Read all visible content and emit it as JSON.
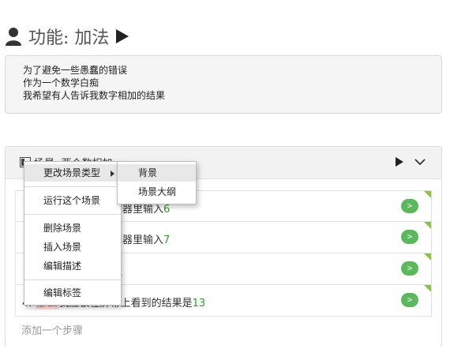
{
  "feature": {
    "title": "功能: 加法"
  },
  "description": {
    "lines": [
      "为了避免一些愚蠢的错误",
      "作为一个数学白痴",
      "我希望有人告诉我数字相加的结果"
    ]
  },
  "scenario": {
    "title": "场景: 两个数相加"
  },
  "steps": [
    {
      "prefix": "",
      "keyword": "",
      "text": "算器里输入",
      "arg": "6",
      "run": ">"
    },
    {
      "prefix": "",
      "keyword": "",
      "text": "算器里输入",
      "arg": "7",
      "run": ">"
    },
    {
      "prefix": "",
      "keyword": "",
      "text": "钮",
      "arg": "",
      "run": ">"
    },
    {
      "prefix": "4.",
      "keyword": "那么",
      "text": "我应该在屏幕上看到的结果是",
      "arg": "13",
      "run": ">"
    }
  ],
  "add_step_label": "添加一个步骤",
  "context_menu": {
    "items": [
      "更改场景类型",
      "运行这个场景",
      "删除场景",
      "插入场景",
      "编辑描述",
      "编辑标签"
    ]
  },
  "submenu": {
    "items": [
      "背景",
      "场景大纲"
    ]
  },
  "colors": {
    "accent_green": "#5cb85c",
    "arg_green": "#2e9d2e",
    "keyword_red": "#d9534f"
  }
}
